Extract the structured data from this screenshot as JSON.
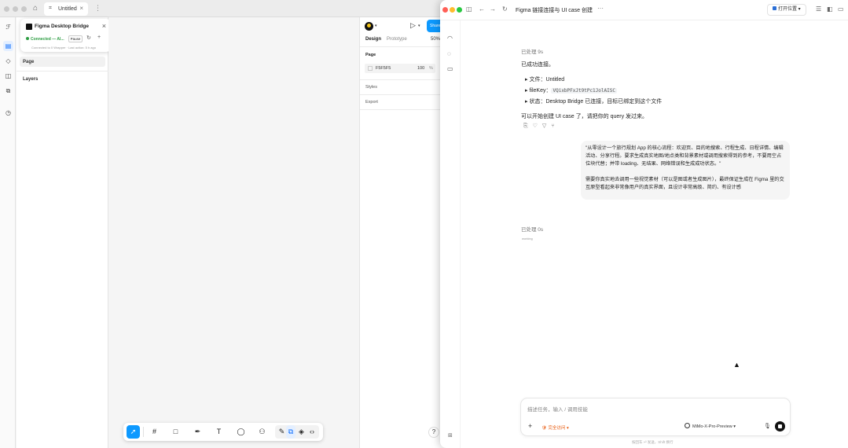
{
  "figma": {
    "tab_label": "Untitled",
    "home_icon": "home-icon",
    "plugin": {
      "title": "Figma Desktop Bridge",
      "status": "Connected — Al...",
      "pause_label": "Pause",
      "subtitle": "Connected to 0 Wrapper · Last action: 5 h ago"
    },
    "left_panel": {
      "pages_label": "Page",
      "layers_label": "Layers"
    },
    "right_panel": {
      "share_label": "Share",
      "tab_design": "Design",
      "tab_prototype": "Prototype",
      "zoom": "50%",
      "page_header": "Page",
      "fill_hex": "F5F5F5",
      "fill_opacity": "100",
      "fill_pct": "%",
      "styles_header": "Styles",
      "export_header": "Export"
    },
    "help_label": "?"
  },
  "chat": {
    "title": "Figma 链接连接与 UI case 创建",
    "open_label": "打开位置",
    "ai1": {
      "status": "已处理 9s",
      "line1": "已成功连接。",
      "bullets": [
        {
          "label": "文件：",
          "value": "Untitled"
        },
        {
          "label": "fileKey：",
          "value": "VQixbPFxJt9tPc1JolAISC"
        },
        {
          "label": "状态：",
          "value": "Desktop Bridge 已连接，目标已绑定到这个文件"
        }
      ],
      "line2": "可以开始创建 UI case 了，请把你的 query 发过来。"
    },
    "user_msg": {
      "p1": "\"从零设计一个旅行规划 App 的核心流程：欢迎页、目的地搜索、行程生成、日程详情、编辑活动、分享行程。要求生成真实地图/地点类和背景素材或调用搜索得到的参考，不要用空占位块代替；并带 loading、无结果、网络错误和生成成功状态。\"",
      "p2": "需要你真实地去调用一些视觉素材（可以是图或者生成图片），最终保证生成在 Figma 里的交互原型看起来非常像用户的真实界面，且设计非常高级、简约、有设计感"
    },
    "ai2": {
      "status": "已处理 0s",
      "sub": "working"
    },
    "input": {
      "placeholder": "描述任务，输入 / 调用技能",
      "security": "完全访问",
      "model": "MiMo-X-Pro-Preview"
    },
    "footer_note": "按回车 ⏎ 发送，Shift 换行"
  }
}
